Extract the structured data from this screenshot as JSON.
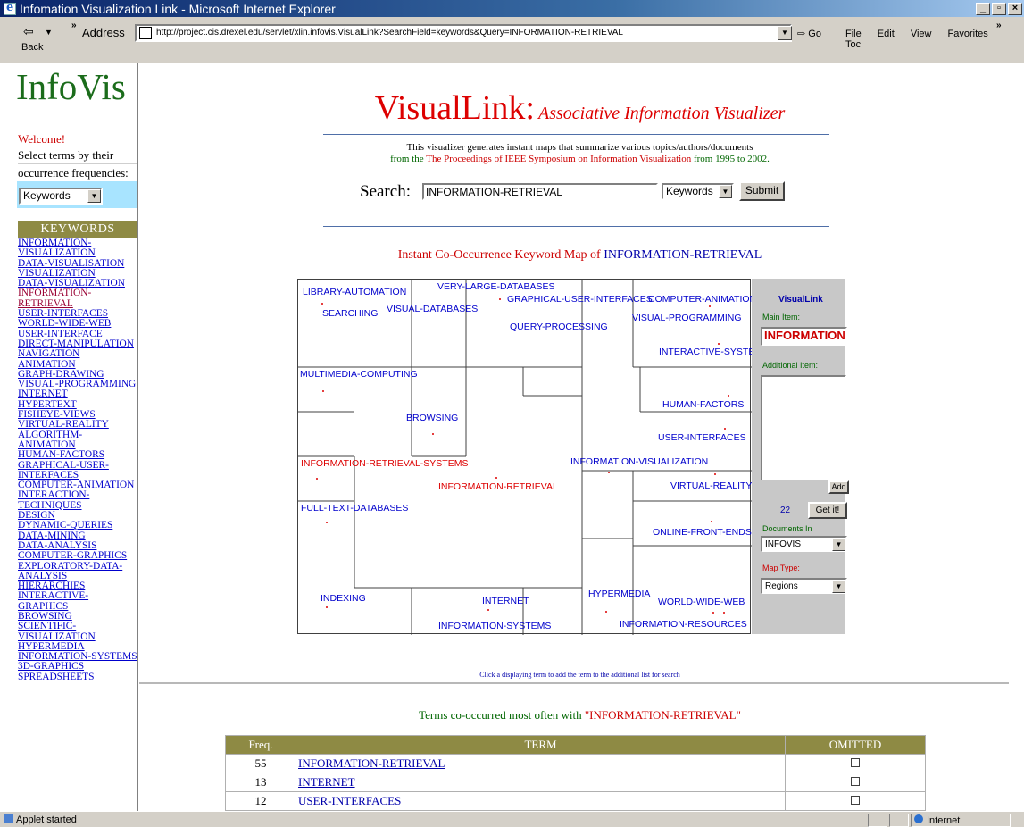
{
  "window": {
    "title": "Infomation Visualization Link - Microsoft Internet Explorer",
    "controls": [
      "_",
      "И",
      "x"
    ]
  },
  "toolbar": {
    "back_label": "Back",
    "address_label": "Address",
    "url": "http://project.cis.drexel.edu/servlet/xlin.infovis.VisualLink?SearchField=keywords&Query=INFORMATION-RETRIEVAL",
    "go_label": "Go",
    "menu": [
      "File",
      "Edit",
      "View",
      "Favorites",
      "Toc"
    ]
  },
  "sidebar": {
    "logo": "InfoVis",
    "welcome": "Welcome!",
    "instruction_lines": [
      "Select terms by their",
      "occurrence frequencies:"
    ],
    "field_select": "Keywords",
    "header": "KEYWORDS",
    "keywords": [
      "INFORMATION-VISUALIZATION",
      "DATA-VISUALISATION",
      "VISUALIZATION",
      "DATA-VISUALIZATION",
      "INFORMATION-RETRIEVAL",
      "USER-INTERFACES",
      "WORLD-WIDE-WEB",
      "USER-INTERFACE",
      "DIRECT-MANIPULATION",
      "NAVIGATION",
      "ANIMATION",
      "GRAPH-DRAWING",
      "VISUAL-PROGRAMMING",
      "INTERNET",
      "HYPERTEXT",
      "FISHEYE-VIEWS",
      "VIRTUAL-REALITY",
      "ALGORITHM-ANIMATION",
      "HUMAN-FACTORS",
      "GRAPHICAL-USER-INTERFACES",
      "COMPUTER-ANIMATION",
      "INTERACTION-TECHNIQUES",
      "DESIGN",
      "DYNAMIC-QUERIES",
      "DATA-MINING",
      "DATA-ANALYSIS",
      "COMPUTER-GRAPHICS",
      "EXPLORATORY-DATA-ANALYSIS",
      "HIERARCHIES",
      "INTERACTIVE-GRAPHICS",
      "BROWSING",
      "SCIENTIFIC-VISUALIZATION",
      "HYPERMEDIA",
      "INFORMATION-SYSTEMS",
      "3D-GRAPHICS",
      "SPREADSHEETS"
    ]
  },
  "main": {
    "title_big": "VisualLink:",
    "title_sub": "Associative Information Visualizer",
    "desc_line1": "This visualizer generates instant maps that summarize various topics/authors/documents",
    "desc_line2_pre": "from the",
    "desc_link": "The Proceedings of IEEE Symposium on Information Visualization",
    "desc_line2_post": "from 1995 to 2002.",
    "search_label": "Search:",
    "search_value": "INFORMATION-RETRIEVAL",
    "search_field": "Keywords",
    "submit_label": "Submit",
    "map_heading_pre": "Instant Co-Occurrence Keyword Map of",
    "map_heading_term": "INFORMATION-RETRIEVAL",
    "click_note": "Click a displaying term to add the term to the additional list for search",
    "co_heading_pre": "Terms co-occurred most often with",
    "co_heading_term": "\"INFORMATION-RETRIEVAL\""
  },
  "map_terms": {
    "library_automation": "LIBRARY-AUTOMATION",
    "searching": "SEARCHING",
    "very_large_databases": "VERY-LARGE-DATABASES",
    "visual_databases": "VISUAL-DATABASES",
    "graphical_user_interfaces": "GRAPHICAL-USER-INTERFACES",
    "computer_animation": "COMPUTER-ANIMATION",
    "visual_programming": "VISUAL-PROGRAMMING",
    "query_processing": "QUERY-PROCESSING",
    "interactive_systems": "INTERACTIVE-SYSTEMS",
    "multimedia_computing": "MULTIMEDIA-COMPUTING",
    "human_factors": "HUMAN-FACTORS",
    "browsing": "BROWSING",
    "user_interfaces": "USER-INTERFACES",
    "information_retrieval_systems": "INFORMATION-RETRIEVAL-SYSTEMS",
    "information_visualization": "INFORMATION-VISUALIZATION",
    "information_retrieval": "INFORMATION-RETRIEVAL",
    "virtual_reality": "VIRTUAL-REALITY",
    "full_text_databases": "FULL-TEXT-DATABASES",
    "online_front_ends": "ONLINE-FRONT-ENDS",
    "indexing": "INDEXING",
    "internet": "INTERNET",
    "hypermedia": "HYPERMEDIA",
    "world_wide_web": "WORLD-WIDE-WEB",
    "information_systems": "INFORMATION-SYSTEMS",
    "information_resources": "INFORMATION-RESOURCES"
  },
  "panel": {
    "title": "VisualLink",
    "main_item_label": "Main Item:",
    "main_item_value": "INFORMATION",
    "additional_label": "Additional Item:",
    "add_label": "Add",
    "count": "22",
    "get_label": "Get it!",
    "docs_label": "Documents In",
    "docs_value": "INFOVIS",
    "maptype_label": "Map Type:",
    "maptype_value": "Regions"
  },
  "table": {
    "headers": [
      "Freq.",
      "TERM",
      "OMITTED"
    ],
    "rows": [
      {
        "freq": "55",
        "term": "INFORMATION-RETRIEVAL"
      },
      {
        "freq": "13",
        "term": "INTERNET"
      },
      {
        "freq": "12",
        "term": "USER-INTERFACES"
      }
    ]
  },
  "status": {
    "text": "Applet started",
    "zone": "Internet"
  },
  "colors": {
    "brand_green": "#1b6c1b",
    "title_red": "#dd0000",
    "header_olive": "#8e8a44",
    "link_blue": "#0000cc"
  }
}
